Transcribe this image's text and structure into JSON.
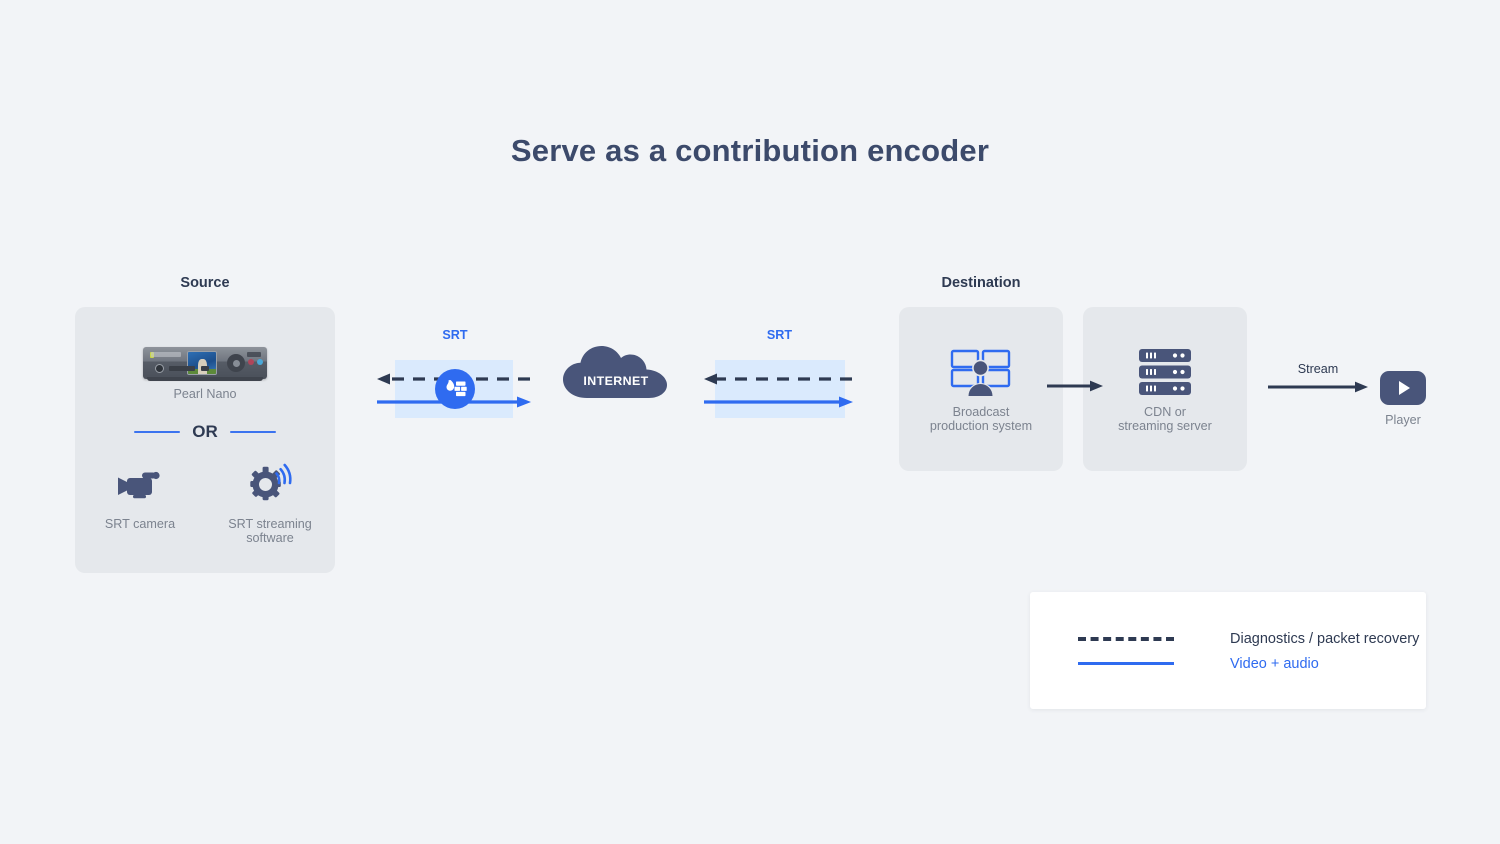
{
  "page": {
    "title": "Serve as a contribution encoder",
    "background_color": "#f2f4f7",
    "title_color": "#3c4a6b"
  },
  "source": {
    "heading": "Source",
    "device": {
      "icon": "pearl-nano-encoder-device",
      "label": "Pearl Nano"
    },
    "divider_label": "OR",
    "alternatives": [
      {
        "icon": "video-camera-icon",
        "label": "SRT camera"
      },
      {
        "icon": "gear-wifi-icon",
        "label": "SRT streaming\nsoftware"
      }
    ]
  },
  "links": {
    "left": {
      "label": "SRT",
      "has_firewall": true,
      "firewall_icon": "firewall-icon"
    },
    "right": {
      "label": "SRT",
      "has_firewall": false
    }
  },
  "cloud": {
    "label": "INTERNET",
    "color": "#49557a"
  },
  "destination": {
    "heading": "Destination",
    "nodes": [
      {
        "icon": "broadcast-production-monitors-icon",
        "label": "Broadcast\nproduction system"
      },
      {
        "icon": "server-rack-icon",
        "label": "CDN or\nstreaming server"
      }
    ],
    "arrow_label": "Stream",
    "player": {
      "icon": "play-button-icon",
      "label": "Player"
    }
  },
  "legend": {
    "items": [
      {
        "style": "dashed",
        "label": "Diagnostics / packet recovery",
        "color": "#2e3a52"
      },
      {
        "style": "solid",
        "label": "Video + audio",
        "color": "#2f6bf0"
      }
    ]
  },
  "colors": {
    "accent_blue": "#2f6bf0",
    "navy": "#2e3a52",
    "panel": "#e5e8ec",
    "band": "#daeafd",
    "muted_text": "#7c838f"
  }
}
